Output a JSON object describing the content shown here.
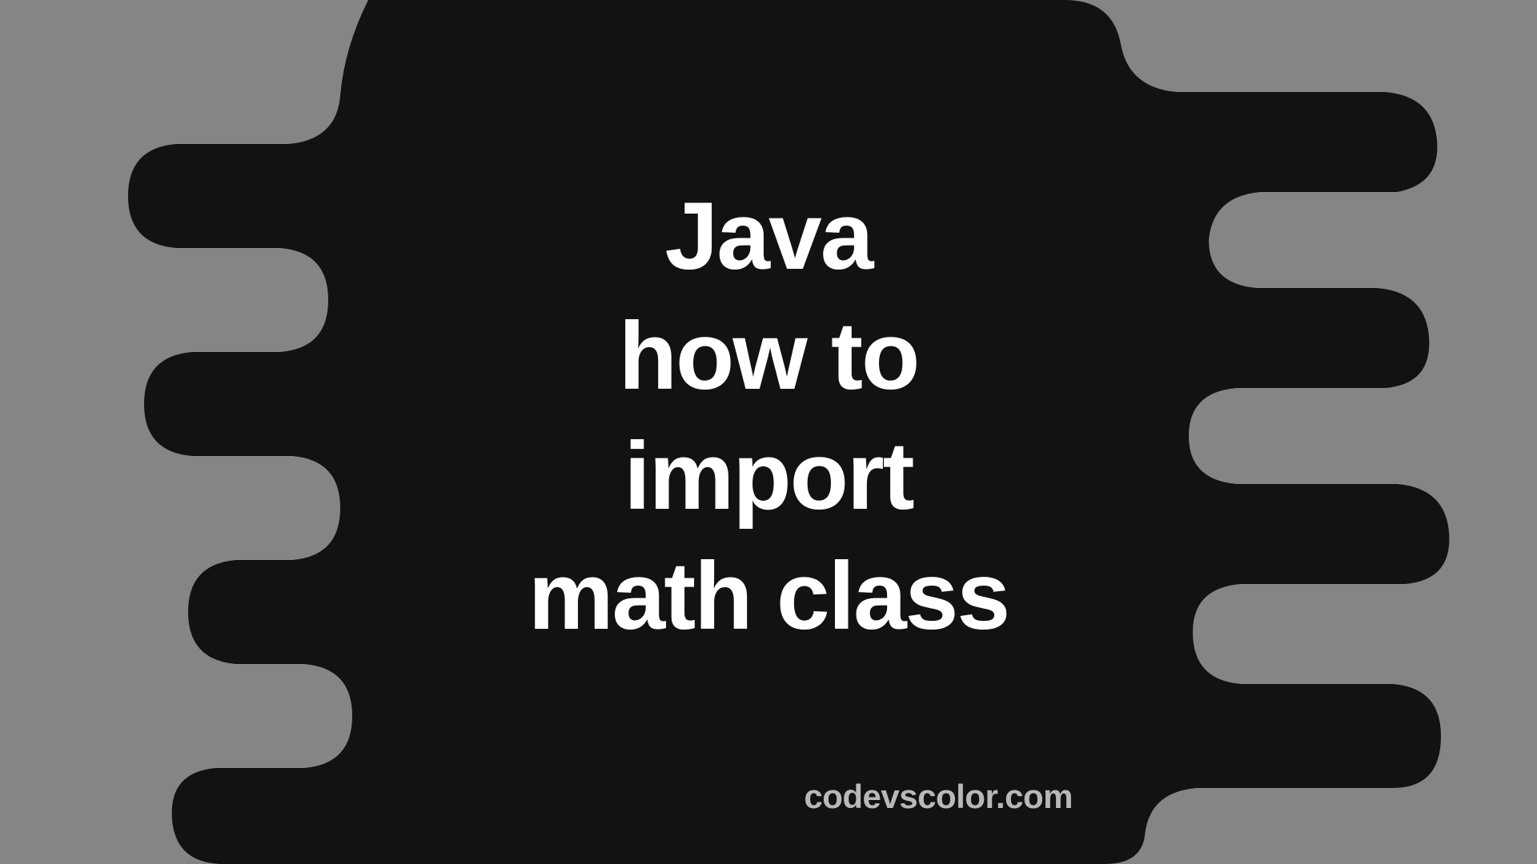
{
  "title": {
    "line1": "Java",
    "line2": "how to",
    "line3": "import",
    "line4": "math class"
  },
  "watermark": "codevscolor.com",
  "colors": {
    "background": "#858585",
    "shape": "#121212",
    "title": "#ffffff",
    "watermark": "#b8b8b8"
  }
}
